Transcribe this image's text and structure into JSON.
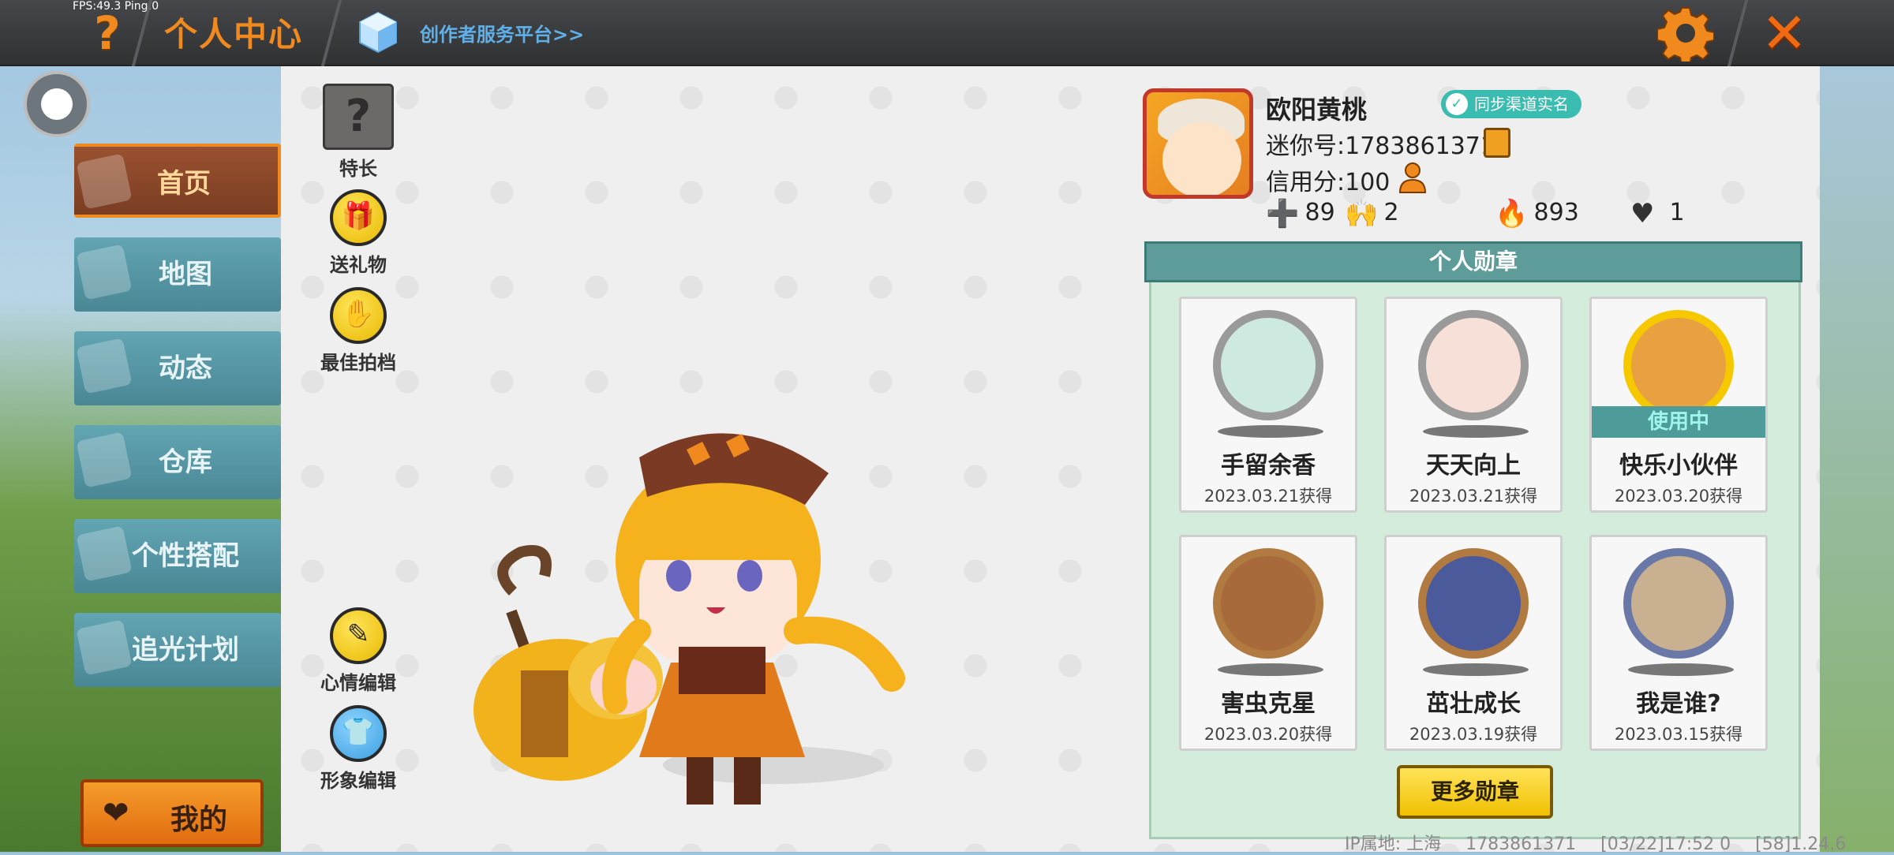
{
  "hud": {
    "fps": "FPS:49.3  Ping:0"
  },
  "topbar": {
    "title": "个人中心",
    "creator_link": "创作者服务平台>>",
    "help_glyph": "?",
    "close_glyph": "✕"
  },
  "sidebar": {
    "items": [
      {
        "label": "首页",
        "icon": "home-icon",
        "active": true
      },
      {
        "label": "地图",
        "icon": "map-icon",
        "active": false
      },
      {
        "label": "动态",
        "icon": "bell-icon",
        "active": false
      },
      {
        "label": "仓库",
        "icon": "warehouse-icon",
        "active": false
      },
      {
        "label": "个性搭配",
        "icon": "outfit-icon",
        "active": false
      },
      {
        "label": "追光计划",
        "icon": "spotlight-icon",
        "active": false
      }
    ],
    "mine_label": "我的"
  },
  "actions": {
    "specialty": {
      "label": "特长",
      "glyph": "?"
    },
    "gift": {
      "label": "送礼物"
    },
    "partner": {
      "label": "最佳拍档"
    },
    "mood": {
      "label": "心情编辑"
    },
    "appearance": {
      "label": "形象编辑"
    }
  },
  "profile": {
    "nickname": "欧阳黄桃",
    "sync_badge": "同步渠道实名",
    "uid": "迷你号:1783861371",
    "credit": "信用分:100",
    "stats": {
      "friends": "89",
      "fans": "2",
      "popularity": "893",
      "likes": "1"
    }
  },
  "medals": {
    "header": "个人勋章",
    "in_use_label": "使用中",
    "items": [
      {
        "name": "手留余香",
        "date": "2023.03.21获得",
        "in_use": false
      },
      {
        "name": "天天向上",
        "date": "2023.03.21获得",
        "in_use": false
      },
      {
        "name": "快乐小伙伴",
        "date": "2023.03.20获得",
        "in_use": true
      },
      {
        "name": "害虫克星",
        "date": "2023.03.20获得",
        "in_use": false
      },
      {
        "name": "茁壮成长",
        "date": "2023.03.19获得",
        "in_use": false
      },
      {
        "name": "我是谁?",
        "date": "2023.03.15获得",
        "in_use": false
      }
    ],
    "more_button": "更多勋章"
  },
  "footer": {
    "ip_location": "IP属地: 上海",
    "uid": "1783861371",
    "timestamp": "[03/22]17:52 0",
    "version": "[58]1.24.6"
  },
  "colors": {
    "accent": "#f08a1e",
    "teal": "#5e9c9a",
    "gold": "#f0c000"
  }
}
